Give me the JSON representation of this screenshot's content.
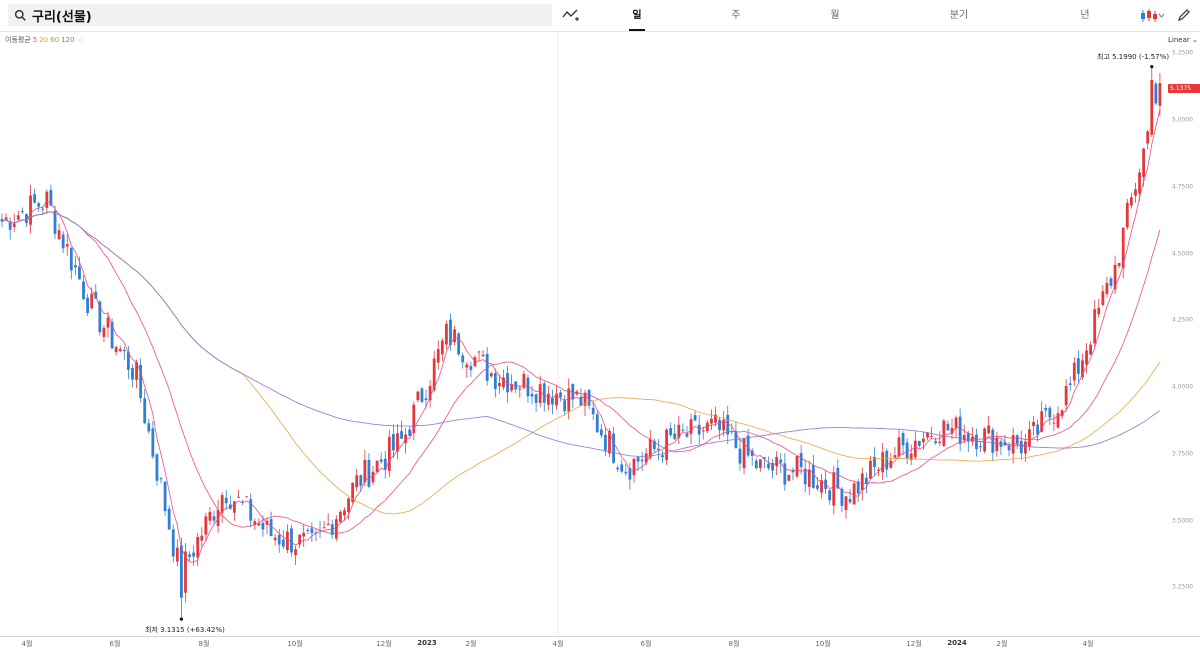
{
  "toolbar": {
    "search_value": "구리(선물)",
    "tabs": [
      "일",
      "주",
      "월",
      "분기",
      "년"
    ],
    "active_tab": "일"
  },
  "legend": {
    "label": "이동평균",
    "ma5": "5",
    "ma20": "20",
    "ma60": "60",
    "ma120": "120"
  },
  "axis": {
    "scale_label": "Linear",
    "y_ticks": [
      "5.2500",
      "5.0000",
      "4.7500",
      "4.5000",
      "4.2500",
      "4.0000",
      "3.7500",
      "3.5000",
      "3.2500"
    ],
    "x_ticks": [
      "4월",
      "6월",
      "8월",
      "10월",
      "12월",
      "2023",
      "2월",
      "4월",
      "6월",
      "8월",
      "10월",
      "12월",
      "2024",
      "2월",
      "4월"
    ]
  },
  "price": {
    "current": "5.1375",
    "high_label": "최고 5.1990 (-1.57%)",
    "low_label": "최저 3.1315 (+63.42%)"
  },
  "colors": {
    "up": "#e5383b",
    "down": "#2f7fd6",
    "ma5": "#e8457b",
    "ma20": "#e6a23c",
    "ma60": "#e38b2e",
    "ma120": "#8a6fd1",
    "price_tag": "#e5383b"
  },
  "chart_data": {
    "type": "candlestick",
    "y_range": [
      3.1315,
      5.199
    ],
    "x_ticks": [
      "4월",
      "6월",
      "8월",
      "10월",
      "12월",
      "2023",
      "2월",
      "4월",
      "6월",
      "8월",
      "10월",
      "12월",
      "2024",
      "2월",
      "4월"
    ],
    "close_path_approx": [
      [
        "2022-03",
        4.62
      ],
      [
        "2022-04",
        4.7
      ],
      [
        "2022-05",
        4.3
      ],
      [
        "2022-06",
        4.05
      ],
      [
        "2022-07",
        3.3
      ],
      [
        "2022-08",
        3.62
      ],
      [
        "2022-09",
        3.45
      ],
      [
        "2022-10",
        3.4
      ],
      [
        "2022-11",
        3.65
      ],
      [
        "2022-12",
        3.8
      ],
      [
        "2023-01",
        4.2
      ],
      [
        "2023-02",
        4.05
      ],
      [
        "2023-03",
        4.0
      ],
      [
        "2023-04",
        3.95
      ],
      [
        "2023-05",
        3.7
      ],
      [
        "2023-06",
        3.8
      ],
      [
        "2023-07",
        3.85
      ],
      [
        "2023-08",
        3.7
      ],
      [
        "2023-09",
        3.68
      ],
      [
        "2023-10",
        3.6
      ],
      [
        "2023-11",
        3.75
      ],
      [
        "2023-12",
        3.85
      ],
      [
        "2024-01",
        3.82
      ],
      [
        "2024-02",
        3.78
      ],
      [
        "2024-03",
        4.0
      ],
      [
        "2024-04",
        4.45
      ],
      [
        "2024-05",
        5.1375
      ]
    ],
    "moving_averages": [
      "5",
      "20",
      "60",
      "120"
    ],
    "high": 5.199,
    "low": 3.1315,
    "last": 5.1375
  }
}
